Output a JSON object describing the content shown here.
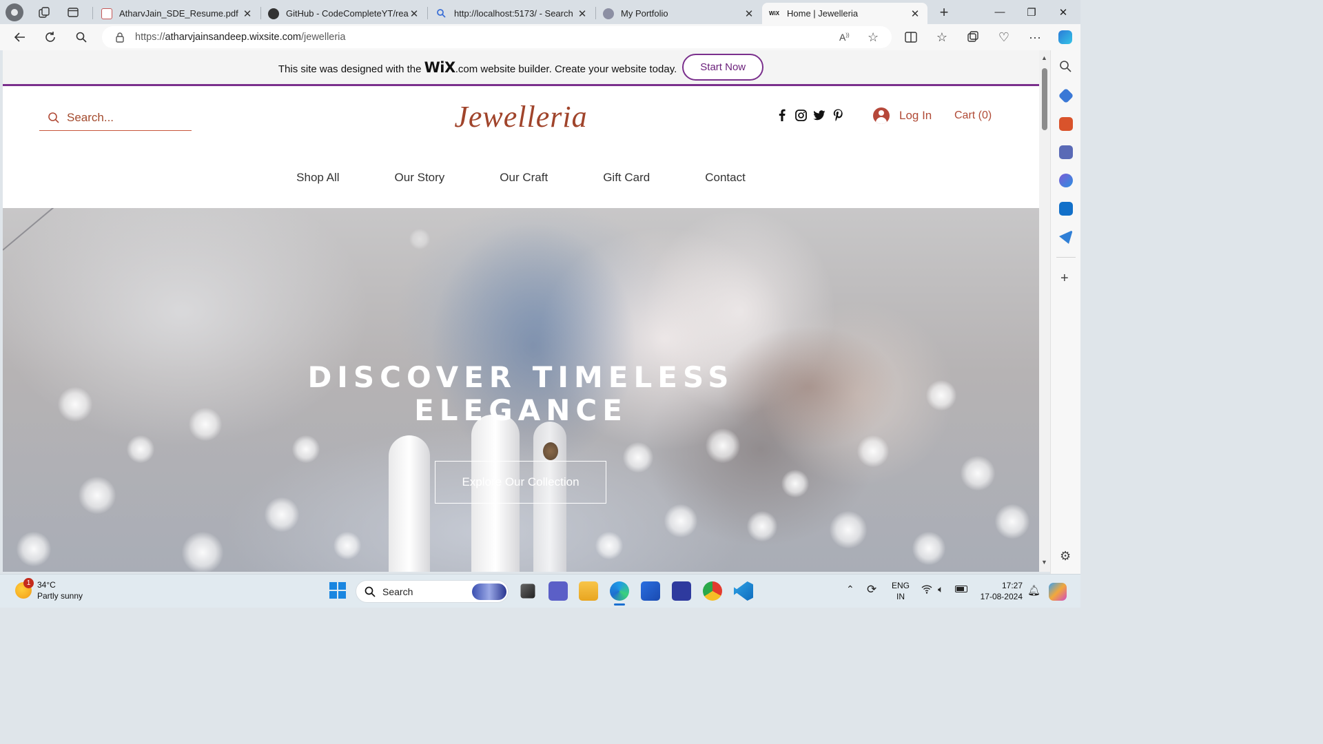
{
  "browser": {
    "tabs": [
      {
        "title": "AtharvJain_SDE_Resume.pdf",
        "icon": "pdf-icon",
        "active": false
      },
      {
        "title": "GitHub - CodeCompleteYT/react",
        "icon": "github-icon",
        "active": false
      },
      {
        "title": "http://localhost:5173/ - Search",
        "icon": "search-icon",
        "active": false
      },
      {
        "title": "My Portfolio",
        "icon": "portfolio-icon",
        "active": false
      },
      {
        "title": "Home | Jewelleria",
        "icon": "wix-icon",
        "active": true
      }
    ],
    "url_prefix": "https://",
    "url_host": "atharvjainsandeep.wixsite.com",
    "url_path": "/jewelleria",
    "wix_fav_text": "WiX"
  },
  "wix_banner": {
    "text_before": "This site was designed with the ",
    "wix_logo": "WiX",
    "text_after": ".com website builder. Create your website today.",
    "start_button": "Start Now"
  },
  "site": {
    "search_placeholder": "Search...",
    "logo": "Jewelleria",
    "social": [
      "facebook-icon",
      "instagram-icon",
      "twitter-icon",
      "pinterest-icon"
    ],
    "login": "Log In",
    "cart": "Cart (0)",
    "nav": [
      "Shop All",
      "Our Story",
      "Our Craft",
      "Gift Card",
      "Contact"
    ],
    "hero_line1": "DISCOVER TIMELESS",
    "hero_line2": "ELEGANCE",
    "hero_cta": "Explore Our Collection"
  },
  "taskbar": {
    "weather_temp": "34°C",
    "weather_desc": "Partly sunny",
    "weather_badge": "1",
    "search_label": "Search",
    "lang_line1": "ENG",
    "lang_line2": "IN",
    "time": "17:27",
    "date": "17-08-2024"
  },
  "colors": {
    "brand": "#a0442b",
    "wix_accent": "#7a2f8c"
  }
}
